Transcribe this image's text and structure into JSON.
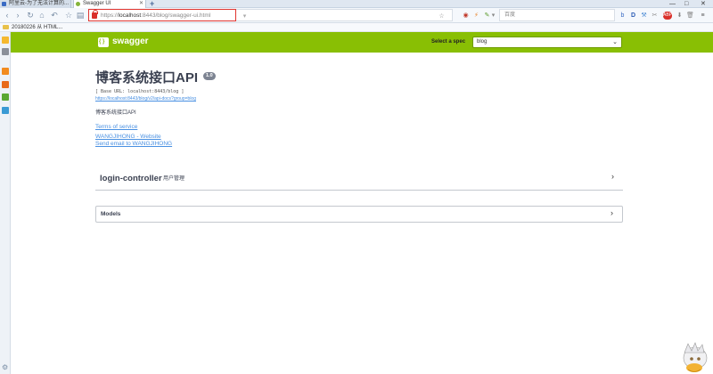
{
  "browser": {
    "tabs": [
      {
        "label": "阿里云-为了无法计算的..."
      },
      {
        "label": "Swagger UI"
      }
    ],
    "new_tab": "+",
    "window_controls": [
      "—",
      "□",
      "✕"
    ],
    "address": {
      "prefix": "https://",
      "host": "localhost",
      "rest": ":8443/blog/swagger-ui.html"
    },
    "search_placeholder": "百度",
    "bookmarks": [
      {
        "label": "20180226 从 HTML..."
      }
    ]
  },
  "swagger": {
    "brand": "swagger",
    "select_spec_label": "Select a spec",
    "selected_spec": "blog",
    "accent_color": "#89bf04"
  },
  "info": {
    "title": "博客系统接口API",
    "version": "1.0",
    "base_url": "[ Base URL: localhost:8443/blog ]",
    "docs_link": "https://localhost:8443/blog/v2/api-docs?group=blog",
    "description": "博客系统接口API",
    "terms": "Terms of service",
    "website": "WANGJIHONG - Website",
    "email": "Send email to WANGJIHONG"
  },
  "controllers": [
    {
      "name": "login-controller",
      "description": "用户管理"
    }
  ],
  "models": {
    "label": "Models"
  }
}
